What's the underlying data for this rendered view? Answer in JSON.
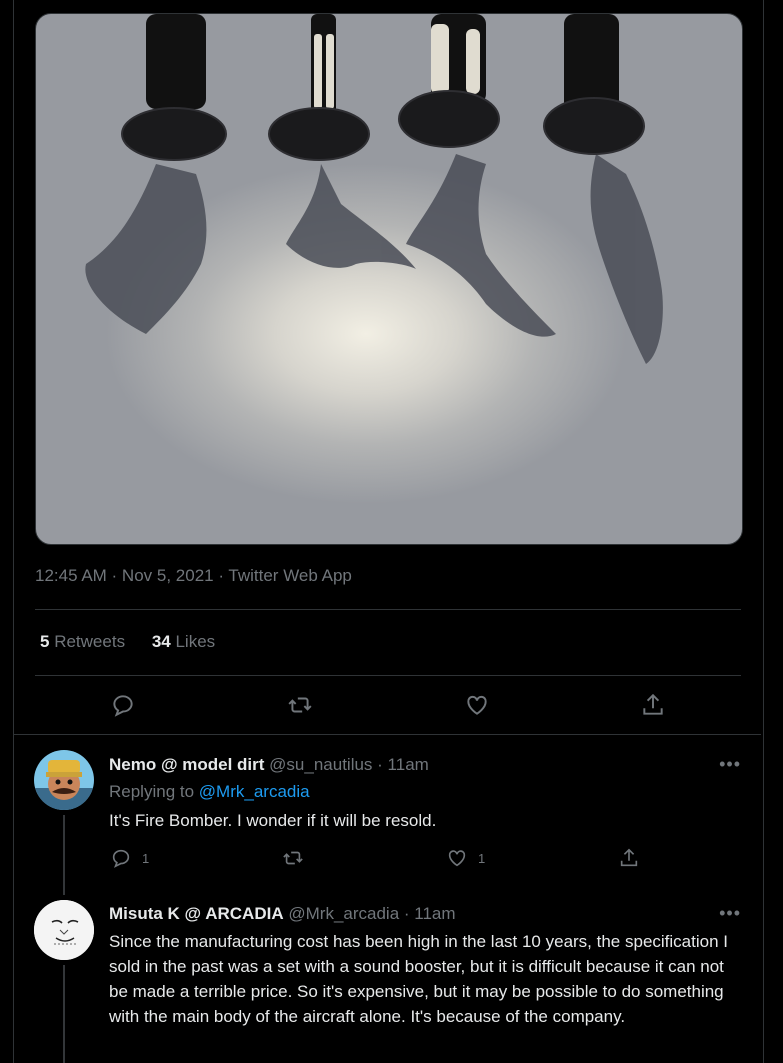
{
  "tweet": {
    "timestamp": "12:45 AM · Nov 5, 2021 · Twitter Web App",
    "retweets_count": "5",
    "retweets_label": "Retweets",
    "likes_count": "34",
    "likes_label": "Likes"
  },
  "replies": [
    {
      "name": "Nemo @ model dirt",
      "handle": "@su_nautilus",
      "time": "· 11am",
      "replying_to_label": "Replying to",
      "replying_to_handle": "@Mrk_arcadia",
      "text": "It's Fire Bomber. I wonder if it will be resold.",
      "reply_count": "1",
      "like_count": "1",
      "more": "•••"
    },
    {
      "name": "Misuta K @ ARCADIA",
      "handle": "@Mrk_arcadia",
      "time": "· 11am",
      "text": "Since the manufacturing cost has been high in the last 10 years, the specification I sold in the past was a set with a sound booster, but it is difficult because it can not be made a terrible price. So it's expensive, but it may be possible to do something with the main body of the aircraft alone. It's because of the company.",
      "more": "•••"
    }
  ],
  "colors": {
    "background": "#000000",
    "text": "#e7e9ea",
    "muted": "#71767b",
    "link": "#1d9bf0",
    "border": "#2f3336"
  },
  "icons": [
    "reply-icon",
    "retweet-icon",
    "like-icon",
    "share-icon",
    "more-icon"
  ]
}
